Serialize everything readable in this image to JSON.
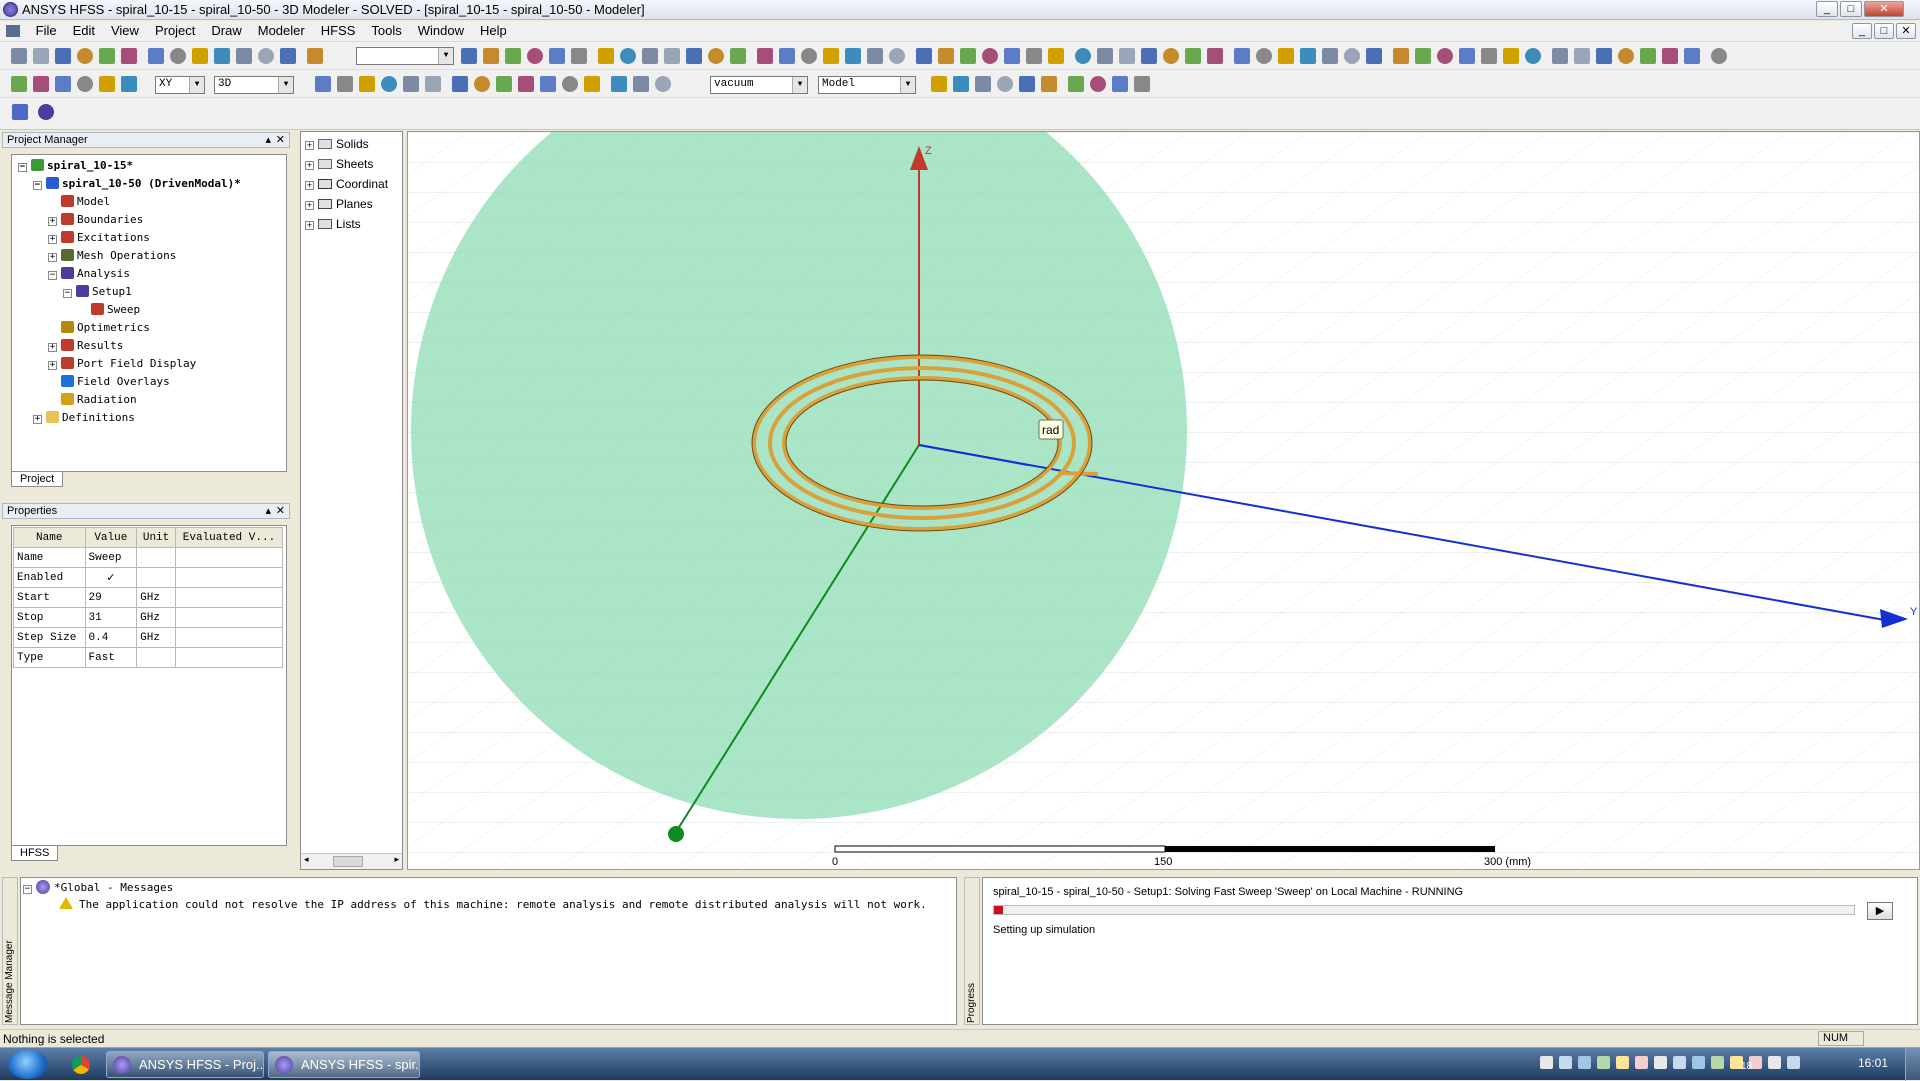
{
  "window": {
    "title": "ANSYS HFSS - spiral_10-15 - spiral_10-50 - 3D Modeler - SOLVED - [spiral_10-15 - spiral_10-50 - Modeler]",
    "controls": [
      "_",
      "□",
      "✕"
    ],
    "mdi_controls": [
      "_",
      "□",
      "✕"
    ]
  },
  "menu": [
    "File",
    "Edit",
    "View",
    "Project",
    "Draw",
    "Modeler",
    "HFSS",
    "Tools",
    "Window",
    "Help"
  ],
  "toolbar": {
    "plane_select": "XY",
    "dim_select": "3D",
    "material_select": "vacuum",
    "model_select": "Model"
  },
  "project_manager": {
    "title": "Project Manager",
    "tab": "Project",
    "tree": [
      {
        "label": "spiral_10-15*",
        "level": 0,
        "expander": "−",
        "bold": true,
        "icon_color": "#3a9a3a"
      },
      {
        "label": "spiral_10-50 (DrivenModal)*",
        "level": 1,
        "expander": "−",
        "bold": true,
        "icon_color": "#2a5bd7"
      },
      {
        "label": "Model",
        "level": 2,
        "expander": "",
        "icon_color": "#c0392b"
      },
      {
        "label": "Boundaries",
        "level": 2,
        "expander": "+",
        "icon_color": "#c0392b"
      },
      {
        "label": "Excitations",
        "level": 2,
        "expander": "+",
        "icon_color": "#c0392b"
      },
      {
        "label": "Mesh Operations",
        "level": 2,
        "expander": "+",
        "icon_color": "#556b2f"
      },
      {
        "label": "Analysis",
        "level": 2,
        "expander": "−",
        "icon_color": "#4b3c9e"
      },
      {
        "label": "Setup1",
        "level": 3,
        "expander": "−",
        "icon_color": "#4b3c9e"
      },
      {
        "label": "Sweep",
        "level": 4,
        "expander": "",
        "icon_color": "#c0392b"
      },
      {
        "label": "Optimetrics",
        "level": 2,
        "expander": "",
        "icon_color": "#b8860b"
      },
      {
        "label": "Results",
        "level": 2,
        "expander": "+",
        "icon_color": "#c0392b"
      },
      {
        "label": "Port Field Display",
        "level": 2,
        "expander": "+",
        "icon_color": "#c0392b"
      },
      {
        "label": "Field Overlays",
        "level": 2,
        "expander": "",
        "icon_color": "#1e6fd9"
      },
      {
        "label": "Radiation",
        "level": 2,
        "expander": "",
        "icon_color": "#d4a017"
      },
      {
        "label": "Definitions",
        "level": 1,
        "expander": "+",
        "icon_color": "#e8c35a"
      }
    ]
  },
  "properties": {
    "title": "Properties",
    "tab": "HFSS",
    "columns": [
      "Name",
      "Value",
      "Unit",
      "Evaluated V..."
    ],
    "rows": [
      [
        "Name",
        "Sweep",
        "",
        ""
      ],
      [
        "Enabled",
        "✓",
        "",
        ""
      ],
      [
        "Start",
        "29",
        "GHz",
        ""
      ],
      [
        "Stop",
        "31",
        "GHz",
        ""
      ],
      [
        "Step Size",
        "0.4",
        "GHz",
        ""
      ],
      [
        "Type",
        "Fast",
        "",
        ""
      ]
    ]
  },
  "model_tree": {
    "items": [
      {
        "label": "Solids",
        "icon_color": "#666"
      },
      {
        "label": "Sheets",
        "icon_color": "#666"
      },
      {
        "label": "Coordinat",
        "icon_color": "#333"
      },
      {
        "label": "Planes",
        "icon_color": "#444"
      },
      {
        "label": "Lists",
        "icon_color": "#555"
      }
    ]
  },
  "viewport": {
    "axis_z": "Z",
    "axis_y": "Y",
    "tooltip": "rad",
    "scale": {
      "labels": [
        "0",
        "150",
        "300 (mm)"
      ]
    },
    "colors": {
      "airbox": "#8fdcb4",
      "coil": "#d9a13b",
      "z_axis": "#c0392b",
      "y_axis": "#1530d0",
      "x_axis": "#0f8a1f"
    }
  },
  "messages": {
    "side_label": "Message Manager",
    "header": "*Global - Messages",
    "items": [
      "The application could not resolve the IP address of this machine: remote analysis and remote distributed analysis will not work."
    ]
  },
  "progress": {
    "side_label": "Progress",
    "task": "spiral_10-15 - spiral_10-50 - Setup1: Solving Fast Sweep 'Sweep' on Local Machine - RUNNING",
    "status": "Setting up simulation",
    "fraction": 0.01
  },
  "statusbar": {
    "text": "Nothing is selected",
    "num": "NUM"
  },
  "taskbar": {
    "tasks": [
      "ANSYS HFSS - Proj...",
      "ANSYS HFSS - spir..."
    ],
    "clock": "16:01",
    "tray_num": "18"
  }
}
